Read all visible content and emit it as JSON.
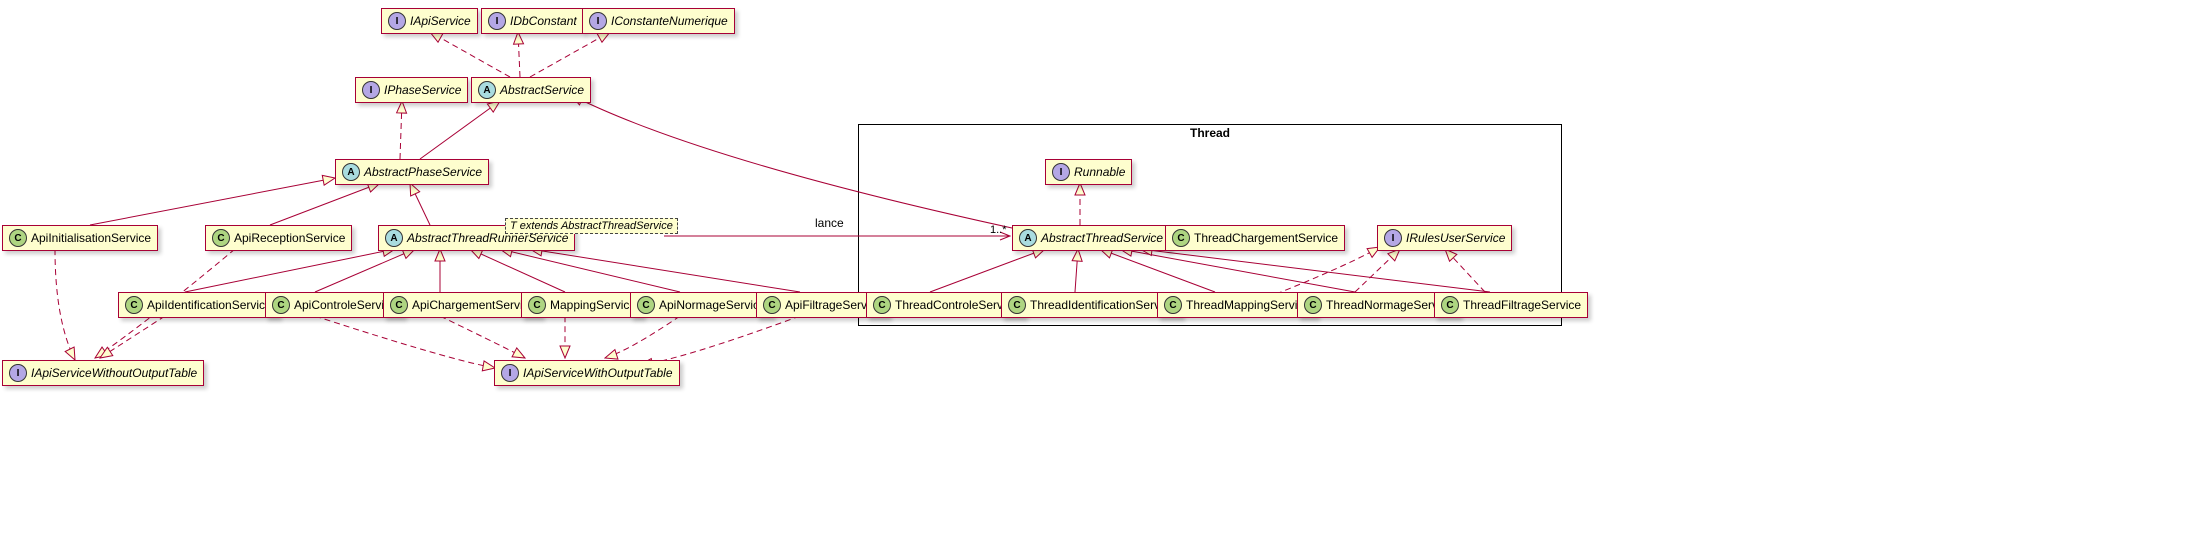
{
  "thread_box": {
    "title": "Thread"
  },
  "nodes": {
    "iApiService": "IApiService",
    "iDbConstant": "IDbConstant",
    "iConstanteNumerique": "IConstanteNumerique",
    "iPhaseService": "IPhaseService",
    "abstractService": "AbstractService",
    "abstractPhaseService": "AbstractPhaseService",
    "apiInitialisationService": "ApiInitialisationService",
    "apiReceptionService": "ApiReceptionService",
    "abstractThreadRunnerService": "AbstractThreadRunnerService",
    "genericParam": "T extends AbstractThreadService",
    "apiIdentificationService": "ApiIdentificationService",
    "apiControleService": "ApiControleService",
    "apiChargementService": "ApiChargementService",
    "mappingService": "MappingService",
    "apiNormageService": "ApiNormageService",
    "apiFiltrageService": "ApiFiltrageService",
    "iApiServiceWithoutOutputTable": "IApiServiceWithoutOutputTable",
    "iApiServiceWithOutputTable": "IApiServiceWithOutputTable",
    "runnable": "Runnable",
    "abstractThreadService": "AbstractThreadService",
    "threadChargementService": "ThreadChargementService",
    "iRulesUserService": "IRulesUserService",
    "threadControleService": "ThreadControleService",
    "threadIdentificationService": "ThreadIdentificationService",
    "threadMappingService": "ThreadMappingService",
    "threadNormageService": "ThreadNormageService",
    "threadFiltrageService": "ThreadFiltrageService"
  },
  "assoc": {
    "lance_label": "lance",
    "lance_mult": "1..*"
  }
}
